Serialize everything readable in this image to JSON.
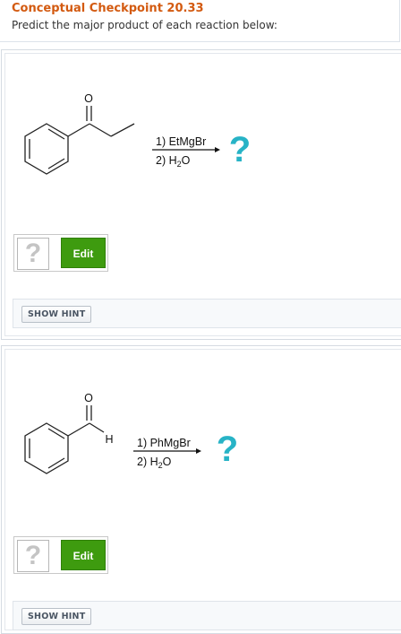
{
  "header": {
    "title": "Conceptual Checkpoint 20.33",
    "subtitle": "Predict the major product of each reaction below:"
  },
  "reactions": [
    {
      "reagent_line1": "1) EtMgBr",
      "reagent_line2_prefix": "2) H",
      "reagent_line2_sub": "2",
      "reagent_line2_suffix": "O",
      "product_placeholder": "?",
      "atom_labels": [
        "O"
      ],
      "answer_placeholder": "?",
      "edit_label": "Edit",
      "hint_label": "SHOW HINT"
    },
    {
      "reagent_line1": "1) PhMgBr",
      "reagent_line2_prefix": "2) H",
      "reagent_line2_sub": "2",
      "reagent_line2_suffix": "O",
      "product_placeholder": "?",
      "atom_labels": [
        "O",
        "H"
      ],
      "answer_placeholder": "?",
      "edit_label": "Edit",
      "hint_label": "SHOW HINT"
    }
  ],
  "colors": {
    "title": "#d35a10",
    "question_mark": "#27b3c6",
    "edit_button": "#3e9b0f"
  }
}
